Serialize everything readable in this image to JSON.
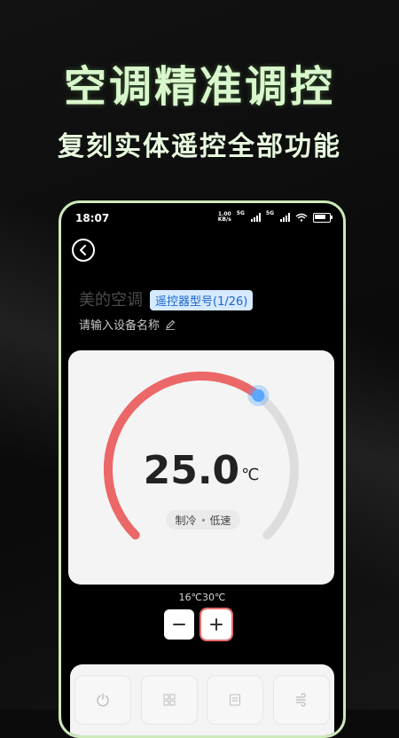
{
  "promo": {
    "title": "空调精准调控",
    "subtitle": "复刻实体遥控全部功能"
  },
  "status_bar": {
    "time": "18:07",
    "network_speed_value": "1.00",
    "network_speed_unit": "KB/s",
    "sig1_label": "5G",
    "sig2_label": "5G"
  },
  "header": {
    "device_name": "美的空调",
    "model_badge": "遥控器型号(1/26)",
    "name_input_placeholder": "请输入设备名称"
  },
  "thermostat": {
    "temperature": "25.0",
    "unit": "℃",
    "mode": "制冷",
    "fan": "低速",
    "range_min": "16℃",
    "range_max": "30℃",
    "level": 0.64
  },
  "stepper": {
    "minus": "−",
    "plus": "+"
  },
  "colors": {
    "accent_red": "#ec6767",
    "knob_blue": "#5aa8ff",
    "track_gray": "#dddddd",
    "promo_green": "#d9f7cc"
  },
  "bottom_buttons": [
    {
      "icon": "power-icon"
    },
    {
      "icon": "grid-icon"
    },
    {
      "icon": "list-icon"
    },
    {
      "icon": "wind-icon"
    }
  ]
}
